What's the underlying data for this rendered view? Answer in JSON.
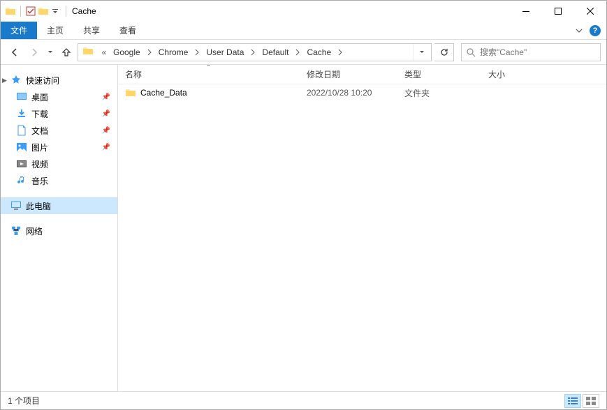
{
  "window": {
    "title": "Cache"
  },
  "ribbon": {
    "file": "文件",
    "home": "主页",
    "share": "共享",
    "view": "查看"
  },
  "breadcrumb": {
    "overflow": "«",
    "segments": [
      "Google",
      "Chrome",
      "User Data",
      "Default",
      "Cache"
    ]
  },
  "search": {
    "placeholder": "搜索\"Cache\""
  },
  "sidebar": {
    "quick_access": "快速访问",
    "items": [
      {
        "label": "桌面",
        "pinned": true
      },
      {
        "label": "下载",
        "pinned": true
      },
      {
        "label": "文档",
        "pinned": true
      },
      {
        "label": "图片",
        "pinned": true
      },
      {
        "label": "视频",
        "pinned": false
      },
      {
        "label": "音乐",
        "pinned": false
      }
    ],
    "this_pc": "此电脑",
    "network": "网络"
  },
  "columns": {
    "name": "名称",
    "modified": "修改日期",
    "type": "类型",
    "size": "大小"
  },
  "rows": [
    {
      "name": "Cache_Data",
      "modified": "2022/10/28 10:20",
      "type": "文件夹",
      "size": ""
    }
  ],
  "status": {
    "count": "1 个项目"
  }
}
